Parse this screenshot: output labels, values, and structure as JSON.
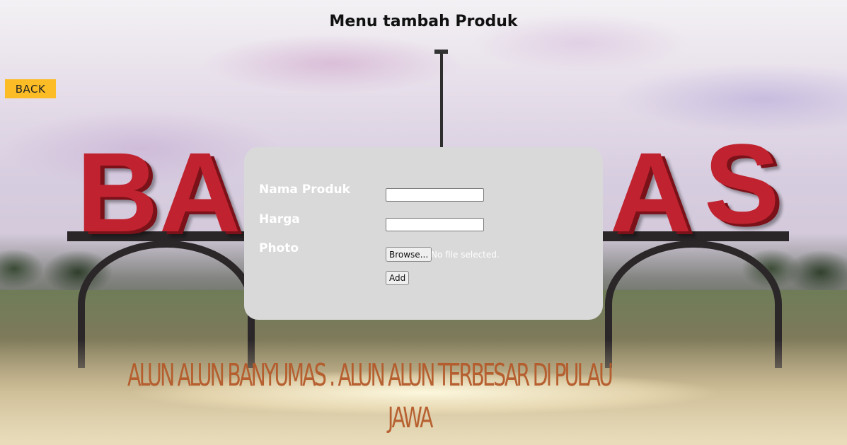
{
  "page": {
    "title": "Menu tambah Produk"
  },
  "nav": {
    "back_label": "BACK"
  },
  "form": {
    "fields": [
      {
        "label": "Nama Produk",
        "value": "",
        "placeholder": ""
      },
      {
        "label": "Harga",
        "value": "",
        "placeholder": ""
      }
    ],
    "photo": {
      "label": "Photo",
      "browse_label": "Browse...",
      "status": "No file selected."
    },
    "submit_label": "Add"
  },
  "background": {
    "sign_letters": [
      "B",
      "A",
      "A",
      "S"
    ],
    "banner_line1": "ALUN ALUN BANYUMAS . ALUN ALUN TERBESAR DI PULAU",
    "banner_line2": "JAWA"
  },
  "colors": {
    "back_button": "#fbbc26",
    "panel": "#d9d9d9",
    "label_text": "#ffffff"
  }
}
